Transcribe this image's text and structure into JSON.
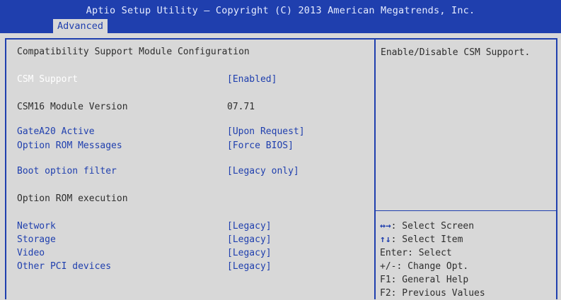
{
  "header": {
    "title": "Aptio Setup Utility – Copyright (C) 2013 American Megatrends, Inc.",
    "tab": "Advanced"
  },
  "main": {
    "section_title": "Compatibility Support Module Configuration",
    "items": [
      {
        "label": "CSM Support",
        "value": "[Enabled]"
      },
      {
        "label": "CSM16 Module Version",
        "value": "07.71"
      },
      {
        "label": "GateA20 Active",
        "value": "[Upon Request]"
      },
      {
        "label": "Option ROM Messages",
        "value": "[Force BIOS]"
      },
      {
        "label": "Boot option filter",
        "value": "[Legacy only]"
      },
      {
        "label": "Option ROM execution",
        "value": ""
      },
      {
        "label": "Network",
        "value": "[Legacy]"
      },
      {
        "label": "Storage",
        "value": "[Legacy]"
      },
      {
        "label": "Video",
        "value": "[Legacy]"
      },
      {
        "label": "Other PCI devices",
        "value": "[Legacy]"
      }
    ]
  },
  "help": {
    "text": "Enable/Disable CSM Support."
  },
  "keys": [
    {
      "key": "↔→",
      "text": ": Select Screen"
    },
    {
      "key": "↑↓",
      "text": ": Select Item"
    },
    {
      "key": "",
      "text": "Enter: Select"
    },
    {
      "key": "",
      "text": "+/-: Change Opt."
    },
    {
      "key": "",
      "text": "F1: General Help"
    },
    {
      "key": "",
      "text": "F2: Previous Values"
    }
  ],
  "colors": {
    "accent": "#1f3fae",
    "background": "#d8d8d8",
    "selected_text": "#ffffff"
  }
}
